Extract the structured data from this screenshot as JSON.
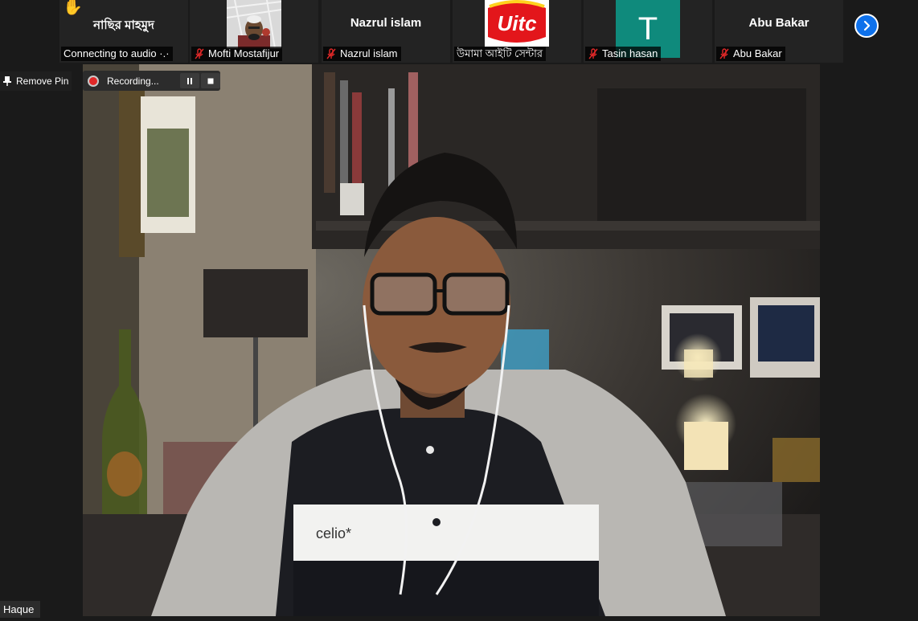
{
  "participants": [
    {
      "display_name": "নাছির মাহমুদ",
      "label": "Connecting to audio ·.·",
      "hand_raised": true,
      "muted": false
    },
    {
      "display_name": "",
      "label": "Mofti Mostafijur",
      "muted": true,
      "thumbnail": "camera-feed"
    },
    {
      "display_name": "Nazrul islam",
      "label": "Nazrul islam",
      "muted": true
    },
    {
      "display_name": "",
      "label": "উমামা আইটি সেন্টার",
      "muted": false,
      "thumbnail": "uitc-logo",
      "logo_text": "Uitc"
    },
    {
      "display_name": "",
      "label": "Tasin hasan",
      "muted": true,
      "avatar_letter": "T",
      "avatar_color": "#0f8a7c"
    },
    {
      "display_name": "Abu Bakar",
      "label": "Abu Bakar",
      "muted": true
    }
  ],
  "controls": {
    "remove_pin": "Remove Pin",
    "recording_status": "Recording..."
  },
  "main_video": {
    "speaker_name": "Haque",
    "shirt_text": "celio*"
  },
  "colors": {
    "accent": "#0e71eb",
    "muted_mic": "#e02828",
    "background": "#1a1a1a"
  }
}
